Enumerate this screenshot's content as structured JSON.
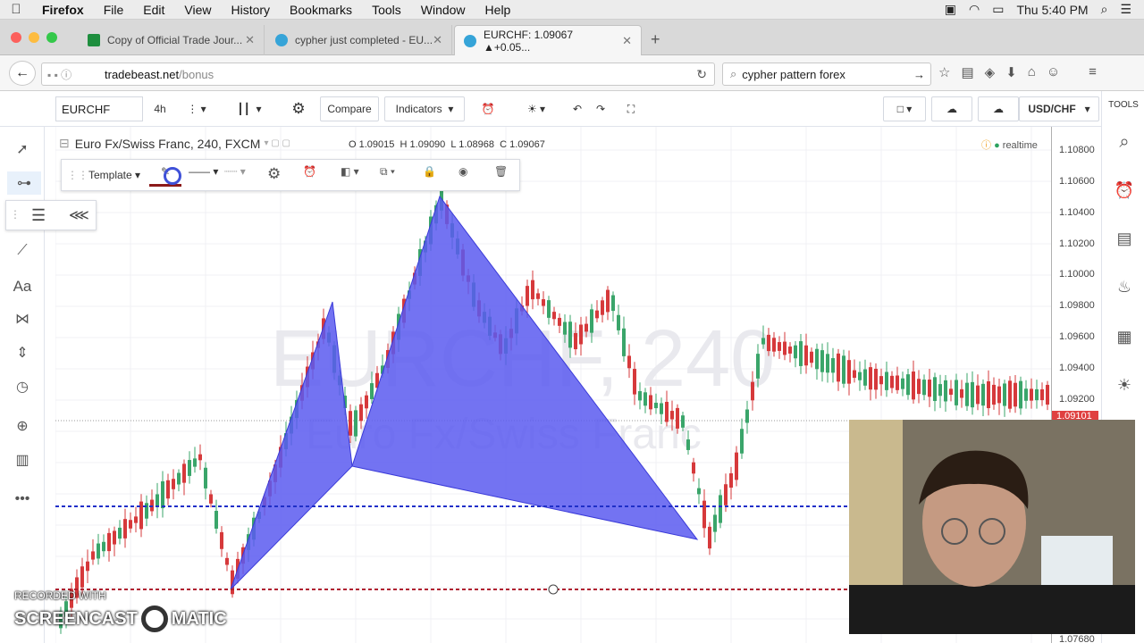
{
  "menubar": {
    "app": "Firefox",
    "items": [
      "File",
      "Edit",
      "View",
      "History",
      "Bookmarks",
      "Tools",
      "Window",
      "Help"
    ],
    "clock": "Thu 5:40 PM"
  },
  "tabs": [
    {
      "title": "Copy of Official Trade Jour...",
      "color": "#1e8e3e"
    },
    {
      "title": "cypher just completed - EU...",
      "color": "#36a4d8"
    },
    {
      "title": "EURCHF: 1.09067 ▲+0.05...",
      "color": "#36a4d8"
    }
  ],
  "nav": {
    "url_host": "tradebeast.net",
    "url_path": "/bonus",
    "search_value": "cypher pattern forex"
  },
  "toolbar": {
    "symbol": "EURCHF",
    "interval": "4h",
    "compare": "Compare",
    "indicators": "Indicators",
    "pair_right": "USD/CHF"
  },
  "legend": {
    "title": "Euro Fx/Swiss Franc, 240, FXCM",
    "o_label": "O",
    "o": "1.09015",
    "h_label": "H",
    "h": "1.09090",
    "l_label": "L",
    "l": "1.08968",
    "c_label": "C",
    "c": "1.09067",
    "status": "realtime"
  },
  "watermark": {
    "symbol": "EURCHF, 240",
    "name": "Euro Fx/Swiss Franc"
  },
  "drawing_toolbar": {
    "template": "Template"
  },
  "price_axis": {
    "labels": [
      "1.10800",
      "1.10600",
      "1.10400",
      "1.10200",
      "1.10000",
      "1.09800",
      "1.09600",
      "1.09400",
      "1.09200",
      "1.07680"
    ],
    "current": "1.09101"
  },
  "right_sidebar": {
    "label": "TOOLS"
  },
  "recording": {
    "line1": "RECORDED WITH",
    "brand_left": "SCREENCAST",
    "brand_right": "MATIC"
  },
  "colors": {
    "pattern_fill": "#5b5bf0",
    "up_candle": "#3aa56a",
    "down_candle": "#d6393b",
    "support_line": "#1f2fc8",
    "resistance_line": "#b02030"
  }
}
